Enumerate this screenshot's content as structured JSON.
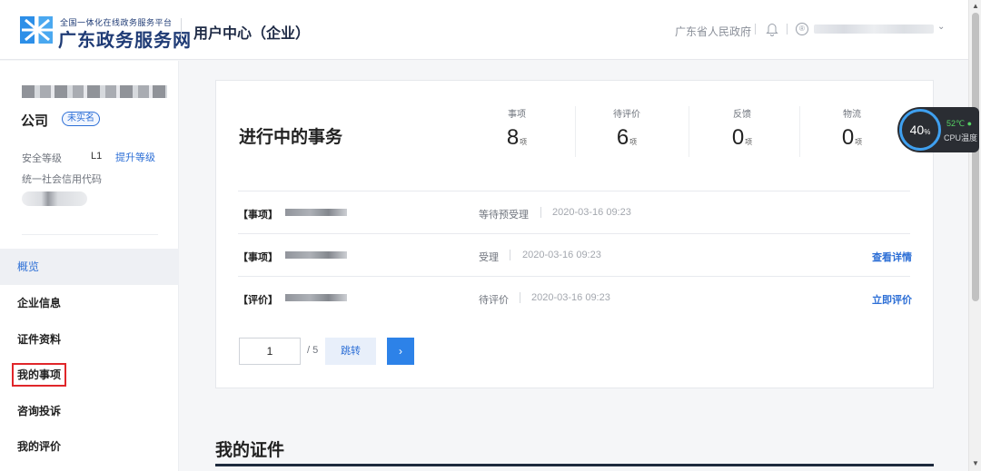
{
  "header": {
    "logo_subtitle": "全国一体化在线政务服务平台",
    "logo_title": "广东政务服务网",
    "center_title": "用户中心（企业）",
    "gov_link": "广东省人民政府",
    "user_icon_glyph": "®"
  },
  "sidebar": {
    "company_suffix": "公司",
    "verify_badge": "未实名",
    "security_label": "安全等级",
    "security_level": "L1",
    "upgrade_link": "提升等级",
    "credit_code_label": "统一社会信用代码",
    "nav": [
      {
        "label": "概览",
        "active": true
      },
      {
        "label": "企业信息",
        "active": false
      },
      {
        "label": "证件资料",
        "active": false
      },
      {
        "label": "我的事项",
        "active": false,
        "highlighted": true
      },
      {
        "label": "咨询投诉",
        "active": false
      },
      {
        "label": "我的评价",
        "active": false
      }
    ]
  },
  "affairs": {
    "title": "进行中的事务",
    "stats": [
      {
        "label": "事项",
        "value": "8",
        "unit": "项"
      },
      {
        "label": "待评价",
        "value": "6",
        "unit": "项"
      },
      {
        "label": "反馈",
        "value": "0",
        "unit": "项"
      },
      {
        "label": "物流",
        "value": "0",
        "unit": "项"
      }
    ],
    "rows": [
      {
        "type": "【事项】",
        "status": "等待预受理",
        "time": "2020-03-16 09:23",
        "action": ""
      },
      {
        "type": "【事项】",
        "status": "受理",
        "time": "2020-03-16 09:23",
        "action": "查看详情"
      },
      {
        "type": "【评价】",
        "status": "待评价",
        "time": "2020-03-16 09:23",
        "action": "立即评价"
      }
    ],
    "pagination": {
      "current": "1",
      "total": "/ 5",
      "jump_label": "跳转",
      "next_glyph": "›"
    }
  },
  "certificates": {
    "title": "我的证件"
  },
  "cpu_widget": {
    "percent": "40",
    "percent_unit": "%",
    "temperature": "52℃",
    "label": "CPU温度"
  },
  "colors": {
    "accent": "#2d6fd6",
    "brand": "#1f3b75",
    "highlight_box": "#e0262a"
  }
}
